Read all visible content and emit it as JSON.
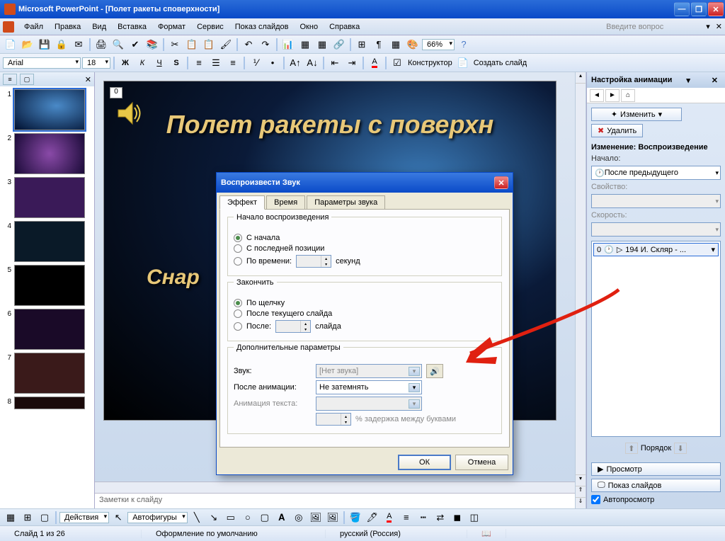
{
  "titlebar": {
    "title": "Microsoft PowerPoint - [Полет ракеты споверхности]"
  },
  "menu": {
    "items": [
      "Файл",
      "Правка",
      "Вид",
      "Вставка",
      "Формат",
      "Сервис",
      "Показ слайдов",
      "Окно",
      "Справка"
    ],
    "help_placeholder": "Введите вопрос"
  },
  "toolbar": {
    "zoom": "66%",
    "designer": "Конструктор",
    "new_slide": "Создать слайд"
  },
  "format_bar": {
    "font": "Arial",
    "size": "18"
  },
  "slide": {
    "title": "Полет ракеты с поверхн",
    "subtitle": "Снар",
    "placeholder_num": "0"
  },
  "notes": {
    "placeholder": "Заметки к слайду"
  },
  "task": {
    "title": "Настройка анимации",
    "change_btn": "Изменить",
    "delete_btn": "Удалить",
    "section": "Изменение: Воспроизведение",
    "start_label": "Начало:",
    "start_value": "После предыдущего",
    "property_label": "Свойство:",
    "speed_label": "Скорость:",
    "anim_item": "194 И. Скляр - ...",
    "anim_num": "0",
    "order": "Порядок",
    "preview": "Просмотр",
    "slideshow": "Показ слайдов",
    "autopreview": "Автопросмотр"
  },
  "dialog": {
    "title": "Воспроизвести Звук",
    "tabs": [
      "Эффект",
      "Время",
      "Параметры звука"
    ],
    "group1": "Начало воспроизведения",
    "r1": "С начала",
    "r2": "С последней позиции",
    "r3": "По времени:",
    "r3_unit": "секунд",
    "group2": "Закончить",
    "r4": "По щелчку",
    "r5": "После текущего слайда",
    "r6": "После:",
    "r6_unit": "слайда",
    "group3": "Дополнительные параметры",
    "sound_label": "Звук:",
    "sound_value": "[Нет звука]",
    "after_label": "После анимации:",
    "after_value": "Не затемнять",
    "text_label": "Анимация текста:",
    "delay_label": "% задержка между буквами",
    "ok": "ОК",
    "cancel": "Отмена"
  },
  "bottom": {
    "actions": "Действия",
    "autoshapes": "Автофигуры"
  },
  "status": {
    "slide": "Слайд 1 из 26",
    "design": "Оформление по умолчанию",
    "lang": "русский (Россия)"
  }
}
